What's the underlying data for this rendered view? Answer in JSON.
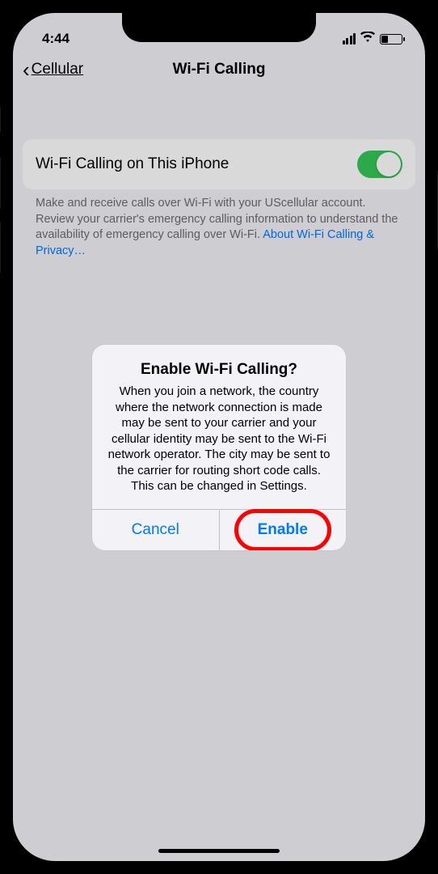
{
  "status": {
    "time": "4:44"
  },
  "nav": {
    "back_label": "Cellular",
    "title": "Wi-Fi Calling"
  },
  "setting": {
    "label": "Wi-Fi Calling on This iPhone",
    "enabled": true
  },
  "footer": {
    "text": "Make and receive calls over Wi-Fi with your UScellular account. Review your carrier's emergency calling information to understand the availability of emergency calling over Wi-Fi. ",
    "link": "About Wi-Fi Calling & Privacy…"
  },
  "alert": {
    "title": "Enable Wi-Fi Calling?",
    "message": "When you join a network, the country where the network connection is made may be sent to your carrier and your cellular identity may be sent to the Wi-Fi network operator. The city may be sent to the carrier for routing short code calls. This can be changed in Settings.",
    "cancel": "Cancel",
    "confirm": "Enable"
  }
}
